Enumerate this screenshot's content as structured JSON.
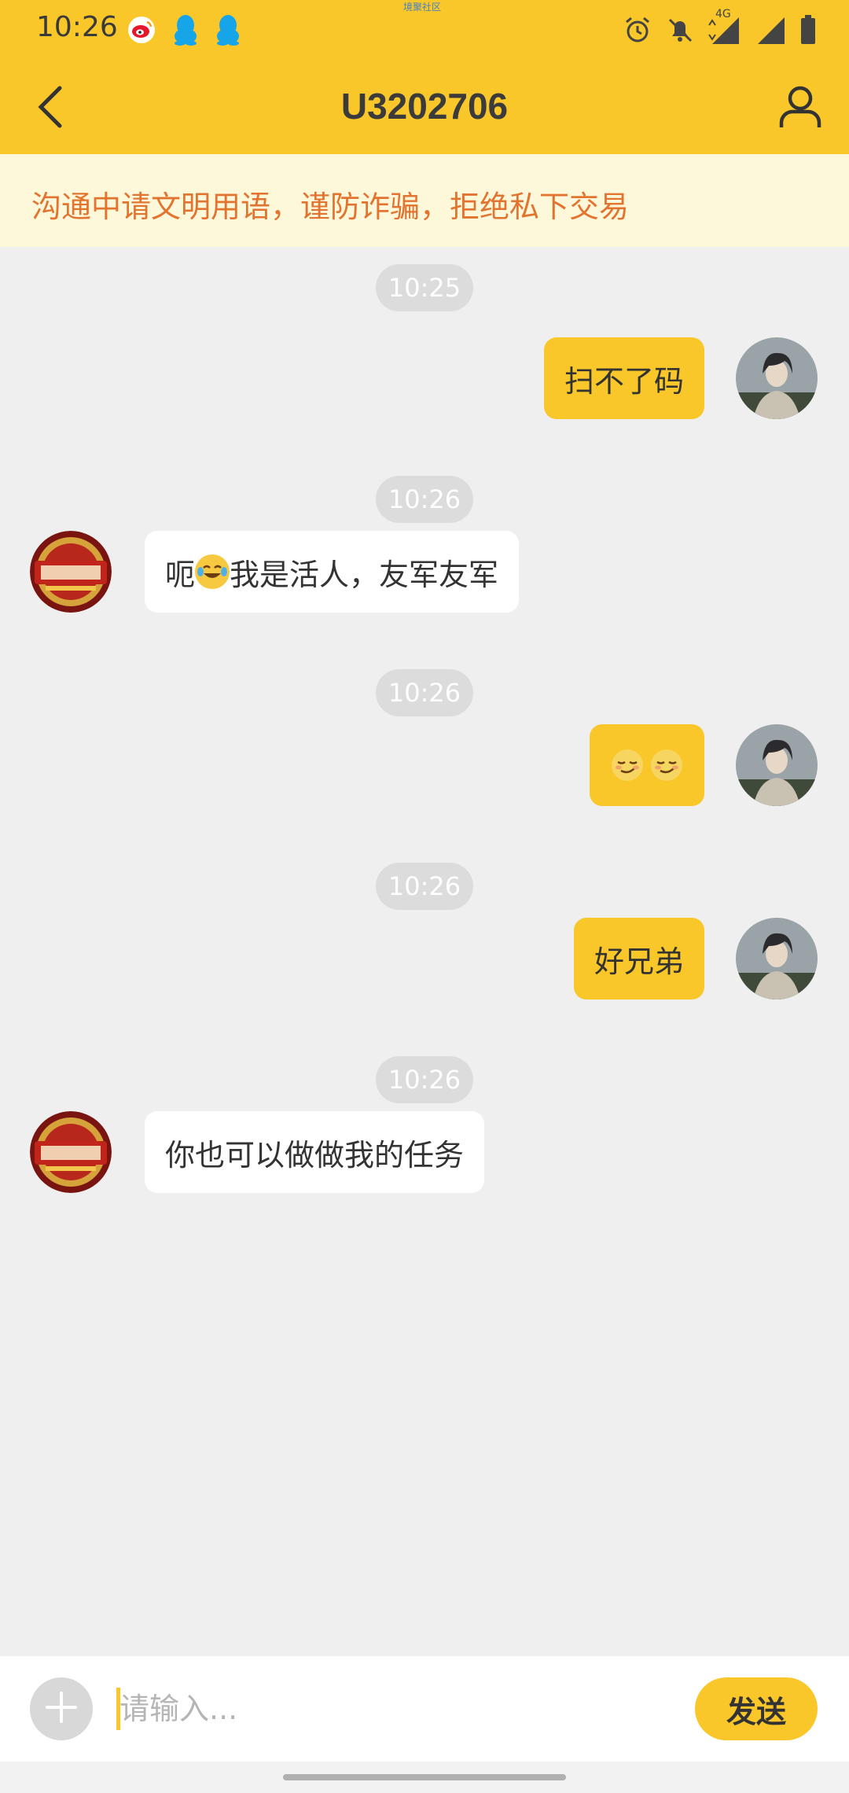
{
  "status_bar": {
    "time": "10:26",
    "app_badge": "境聚社区",
    "icons_left": [
      "weibo-icon",
      "qq-icon",
      "qq-icon"
    ],
    "icons_right": [
      "alarm-icon",
      "bell-muted-icon",
      "signal-4g-icon",
      "signal-icon",
      "battery-icon"
    ],
    "network_label": "4G"
  },
  "header": {
    "title": "U3202706",
    "back_icon": "chevron-left-icon",
    "profile_icon": "user-icon"
  },
  "notice": {
    "text": "沟通中请文明用语，谨防诈骗，拒绝私下交易"
  },
  "messages": [
    {
      "timestamp": "10:25",
      "direction": "out",
      "text": "扫不了码"
    },
    {
      "timestamp": "10:26",
      "direction": "in",
      "text_before_emoji": "呃",
      "emoji": "laughing-tears-emoji",
      "text_after_emoji": "我是活人，友军友军"
    },
    {
      "timestamp": "10:26",
      "direction": "out",
      "emojis": [
        "smirk-emoji",
        "smirk-emoji"
      ]
    },
    {
      "timestamp": "10:26",
      "direction": "out",
      "text": "好兄弟"
    },
    {
      "timestamp": "10:26",
      "direction": "in",
      "text": "你也可以做做我的任务"
    }
  ],
  "composer": {
    "placeholder": "请输入...",
    "value": "",
    "send_label": "发送",
    "plus_icon": "plus-icon"
  },
  "colors": {
    "brand_yellow": "#f9c72a",
    "notice_bg": "#fef8db",
    "notice_text": "#e2742f",
    "chat_bg": "#efefef",
    "timestamp_pill": "#dcdcdc"
  }
}
